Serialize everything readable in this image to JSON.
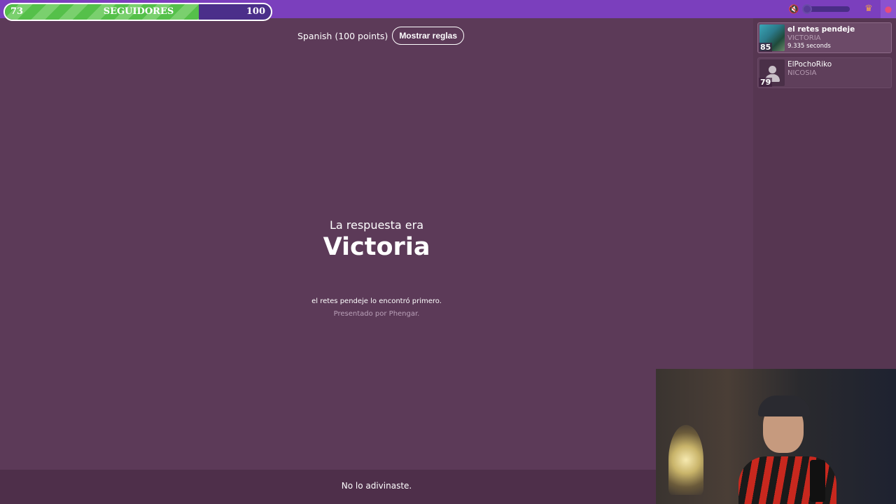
{
  "followers": {
    "current": "73",
    "label": "SEGUIDORES",
    "goal": "100",
    "progress": 0.73
  },
  "header": {
    "language": "Spanish (100 points)",
    "rules_button": "Mostrar reglas"
  },
  "result": {
    "intro": "La respuesta era",
    "answer": "Victoria",
    "found_by": "el retes pendeje lo encontró primero.",
    "credit": "Presentado por Phengar."
  },
  "footer": {
    "message": "No lo adivinaste."
  },
  "players": [
    {
      "score": "85",
      "name": "el retes pendeje",
      "guess": "VICTORIA",
      "time": "9.335 seconds"
    },
    {
      "score": "79",
      "name": "ElPochoRiko",
      "guess": "NICOSIA"
    }
  ],
  "icons": {
    "mute": "speaker-muted-icon",
    "crown": "crown-icon",
    "logo": "app-logo-icon"
  },
  "colors": {
    "accent": "#7b3fbd",
    "background": "#5c3a58",
    "progress": "#55c04a"
  }
}
